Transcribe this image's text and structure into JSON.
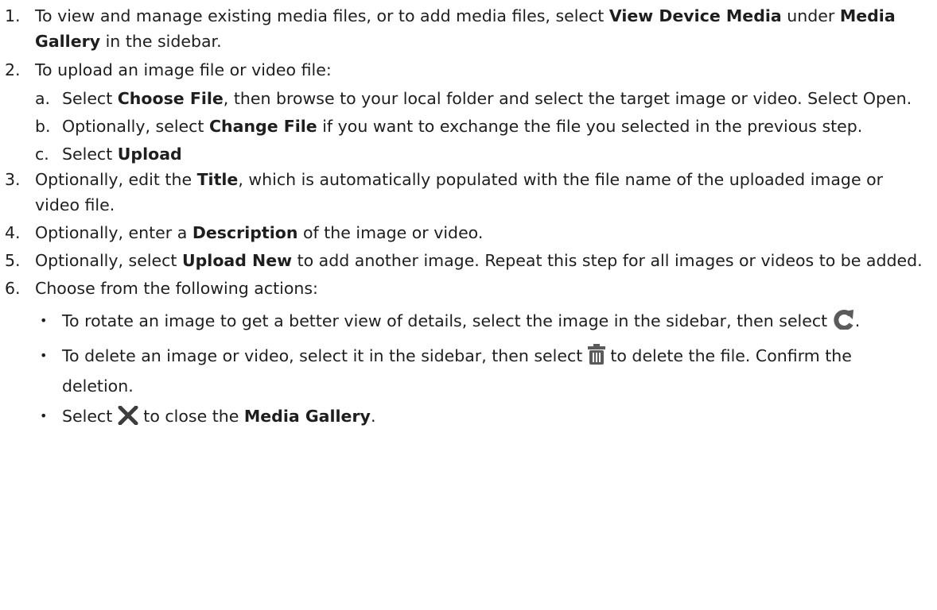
{
  "steps": [
    {
      "num": "1.",
      "t1": "To view and manage existing media files, or to add media files, select ",
      "b1": "View Device Media",
      "t2": " under ",
      "b2": "Media Gallery",
      "t3": " in the sidebar."
    },
    {
      "num": "2.",
      "text": "To upload an image file or video file:",
      "subs": [
        {
          "letter": "a.",
          "t1": "Select ",
          "b1": "Choose File",
          "t2": ", then browse to your local folder and select the target image or video. Select Open."
        },
        {
          "letter": "b.",
          "t1": "Optionally, select ",
          "b1": "Change File",
          "t2": " if you want to exchange the file you selected in the previous step."
        },
        {
          "letter": "c.",
          "t1": "Select ",
          "b1": "Upload"
        }
      ]
    },
    {
      "num": "3.",
      "t1": "Optionally, edit the ",
      "b1": "Title",
      "t2": ", which is automatically populated with the file name of the uploaded image or video file."
    },
    {
      "num": "4.",
      "t1": "Optionally, enter a ",
      "b1": "Description",
      "t2": " of the image or video."
    },
    {
      "num": "5.",
      "t1": "Optionally, select ",
      "b1": "Upload New",
      "t2": " to add another image. Repeat this step for all images or videos to be added."
    },
    {
      "num": "6.",
      "text": "Choose from the following actions:",
      "bullets": [
        {
          "dot": "•",
          "t1": "To rotate an image to get a better view of details, select the image in the sidebar, then select ",
          "icon": "rotate-icon",
          "t2": "."
        },
        {
          "dot": "•",
          "t1": "To delete an image or video, select it in the sidebar, then select ",
          "icon": "trash-icon",
          "t2": " to delete the file. Confirm the deletion."
        },
        {
          "dot": "•",
          "t1": "Select ",
          "icon": "close-icon",
          "t2": " to close the ",
          "b1": "Media Gallery",
          "t3": "."
        }
      ]
    }
  ],
  "colors": {
    "text": "#1e1e1e",
    "icon": "#5b5b5b"
  }
}
